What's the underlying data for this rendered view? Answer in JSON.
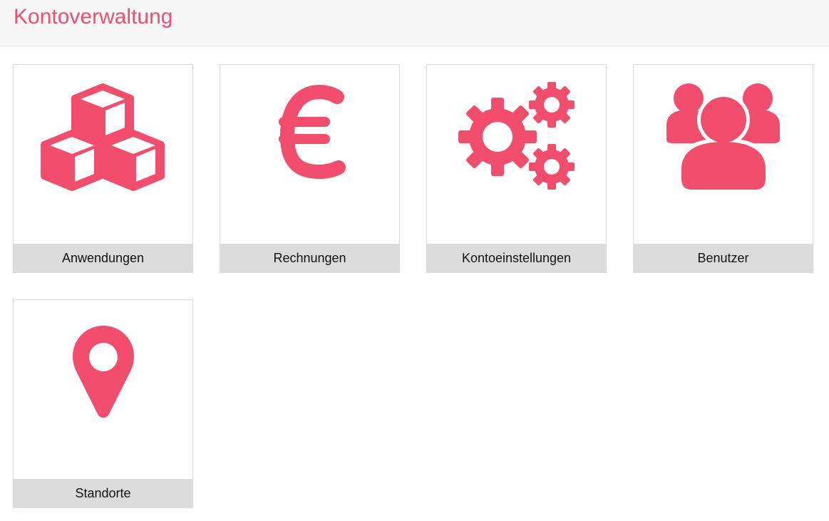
{
  "header": {
    "title": "Kontoverwaltung"
  },
  "colors": {
    "accent": "#f24d6c",
    "header_bg": "#f7f7f7",
    "tile_label_bg": "#dcdcdc"
  },
  "tiles": [
    {
      "label": "Anwendungen",
      "icon": "cubes-icon"
    },
    {
      "label": "Rechnungen",
      "icon": "euro-icon"
    },
    {
      "label": "Kontoeinstellungen",
      "icon": "gears-icon"
    },
    {
      "label": "Benutzer",
      "icon": "users-icon"
    },
    {
      "label": "Standorte",
      "icon": "map-marker-icon"
    }
  ]
}
